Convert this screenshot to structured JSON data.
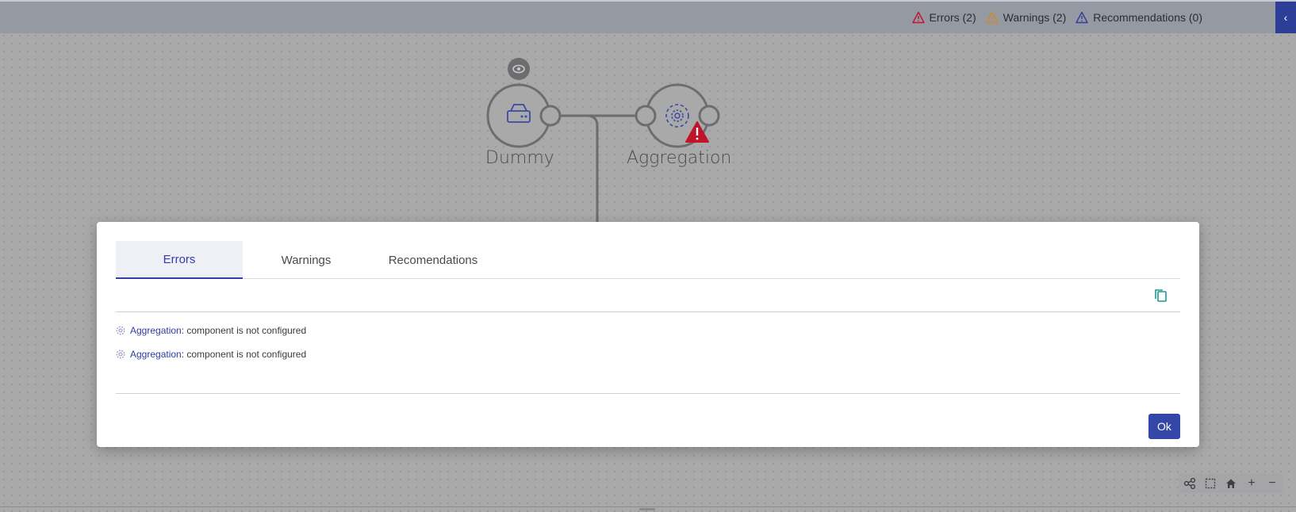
{
  "header": {
    "errors_label": "Errors (2)",
    "warnings_label": "Warnings (2)",
    "recommendations_label": "Recommendations (0)",
    "collapse_icon": "chevron-left-icon"
  },
  "canvas": {
    "nodes": [
      {
        "label": "Dummy",
        "icon": "storage-icon"
      },
      {
        "label": "Aggregation",
        "icon": "gear-icon",
        "status": "error"
      }
    ]
  },
  "dialog": {
    "tabs": [
      "Errors",
      "Warnings",
      "Recomendations"
    ],
    "active_tab": "Errors",
    "messages": [
      {
        "component": "Aggregation",
        "text": ": component is not configured"
      },
      {
        "component": "Aggregation",
        "text": ": component is not configured"
      }
    ],
    "ok_label": "Ok"
  },
  "colors": {
    "accent": "#3446a8",
    "error": "#c0142b",
    "warning": "#d4862a",
    "recommendation": "#2e3da0"
  }
}
